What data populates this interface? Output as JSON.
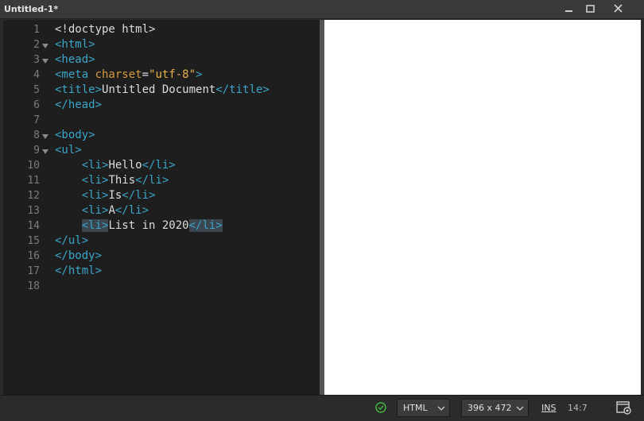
{
  "window": {
    "title": "Untitled-1*",
    "minimize_icon": "minimize-icon",
    "maximize_icon": "maximize-icon",
    "close_icon": "close-icon"
  },
  "editor": {
    "line_numbers": [
      "1",
      "2",
      "3",
      "4",
      "5",
      "6",
      "7",
      "8",
      "9",
      "10",
      "11",
      "12",
      "13",
      "14",
      "15",
      "16",
      "17",
      "18"
    ],
    "fold_lines": [
      2,
      3,
      8,
      9
    ],
    "lines": [
      [
        {
          "t": "plain",
          "v": "<!doctype html>"
        }
      ],
      [
        {
          "t": "tag",
          "v": "<html>"
        }
      ],
      [
        {
          "t": "tag",
          "v": "<head>"
        }
      ],
      [
        {
          "t": "tag",
          "v": "<meta "
        },
        {
          "t": "attr",
          "v": "charset"
        },
        {
          "t": "plain",
          "v": "="
        },
        {
          "t": "str",
          "v": "\"utf-8\""
        },
        {
          "t": "tag",
          "v": ">"
        }
      ],
      [
        {
          "t": "tag",
          "v": "<title>"
        },
        {
          "t": "plain",
          "v": "Untitled Document"
        },
        {
          "t": "tag",
          "v": "</title>"
        }
      ],
      [
        {
          "t": "tag",
          "v": "</head>"
        }
      ],
      [],
      [
        {
          "t": "tag",
          "v": "<body>"
        }
      ],
      [
        {
          "t": "tag",
          "v": "<ul>"
        }
      ],
      [
        {
          "t": "plain",
          "v": "    "
        },
        {
          "t": "tag",
          "v": "<li>"
        },
        {
          "t": "plain",
          "v": "Hello"
        },
        {
          "t": "tag",
          "v": "</li>"
        }
      ],
      [
        {
          "t": "plain",
          "v": "    "
        },
        {
          "t": "tag",
          "v": "<li>"
        },
        {
          "t": "plain",
          "v": "This"
        },
        {
          "t": "tag",
          "v": "</li>"
        }
      ],
      [
        {
          "t": "plain",
          "v": "    "
        },
        {
          "t": "tag",
          "v": "<li>"
        },
        {
          "t": "plain",
          "v": "Is"
        },
        {
          "t": "tag",
          "v": "</li>"
        }
      ],
      [
        {
          "t": "plain",
          "v": "    "
        },
        {
          "t": "tag",
          "v": "<li>"
        },
        {
          "t": "plain",
          "v": "A"
        },
        {
          "t": "tag",
          "v": "</li>"
        }
      ],
      [
        {
          "t": "plain",
          "v": "    "
        },
        {
          "t": "tag",
          "v": "<li>",
          "hl": true
        },
        {
          "t": "plain",
          "v": "List in 2020"
        },
        {
          "t": "tag",
          "v": "</li>",
          "hl": true
        }
      ],
      [
        {
          "t": "tag",
          "v": "</ul>"
        }
      ],
      [
        {
          "t": "tag",
          "v": "</body>"
        }
      ],
      [
        {
          "t": "tag",
          "v": "</html>"
        }
      ],
      []
    ]
  },
  "status": {
    "status_icon": "check-circle-icon",
    "language": "HTML",
    "size": "396 x 472",
    "mode": "INS",
    "cursor": "14:7",
    "live_view_icon": "live-view-icon"
  }
}
